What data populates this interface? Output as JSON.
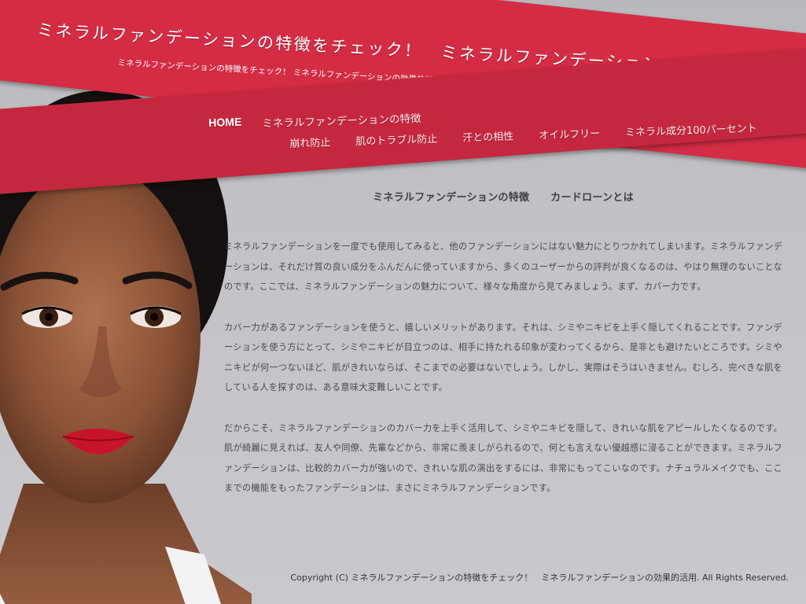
{
  "header": {
    "title": "ミネラルファンデーションの特徴をチェック！　ミネラルファンデーションの効果的活用",
    "description": "ミネラルファンデーションの特徴をチェック！ ミネラルファンデーションの効果的活用では、ミネラルファンデーションに関する特徴をまとめています。"
  },
  "nav": {
    "row1": [
      "HOME",
      "ミネラルファンデーションの特徴"
    ],
    "row2": [
      "崩れ防止",
      "肌のトラブル防止",
      "汗との相性",
      "オイルフリー",
      "ミネラル成分100パーセント"
    ]
  },
  "main": {
    "heading_1": "ミネラルファンデーションの特徴",
    "heading_2": "カードローンとは",
    "paragraphs": [
      "ミネラルファンデーションを一度でも使用してみると、他のファンデーションにはない魅力にとりつかれてしまいます。ミネラルファンデーションは、それだけ質の良い成分をふんだんに使っていますから、多くのユーザーからの評判が良くなるのは、やはり無理のないことなのです。ここでは、ミネラルファンデーションの魅力について、様々な角度から見てみましょう。まず、カバー力です。",
      "カバー力があるファンデーションを使うと、嬉しいメリットがあります。それは、シミやニキビを上手く隠してくれることです。ファンデーションを使う方にとって、シミやニキビが目立つのは、相手に持たれる印象が変わってくるから、是非とも避けたいところです。シミやニキビが何一つないほど、肌がきれいならば、そこまでの必要はないでしょう。しかし、実際はそうはいきません。むしろ、完ぺきな肌をしている人を探すのは、ある意味大変難しいことです。",
      "だからこそ、ミネラルファンデーションのカバー力を上手く活用して、シミやニキビを隠して、きれいな肌をアピールしたくなるのです。肌が綺麗に見えれば、友人や同僚、先輩などから、非常に羨ましがられるので、何とも言えない優越感に浸ることができます。ミネラルファンデーションは、比較的カバー力が強いので、きれいな肌の演出をするには、非常にもってこいなのです。ナチュラルメイクでも、ここまでの機能をもったファンデーションは、まさにミネラルファンデーションです。"
    ]
  },
  "footer": {
    "copyright": "Copyright (C)  ミネラルファンデーションの特徴をチェック！　ミネラルファンデーションの効果的活用.  All Rights Reserved."
  },
  "colors": {
    "ribbon": "#d42c45",
    "background": "#c3c3c7",
    "text": "#4a4a4e"
  }
}
